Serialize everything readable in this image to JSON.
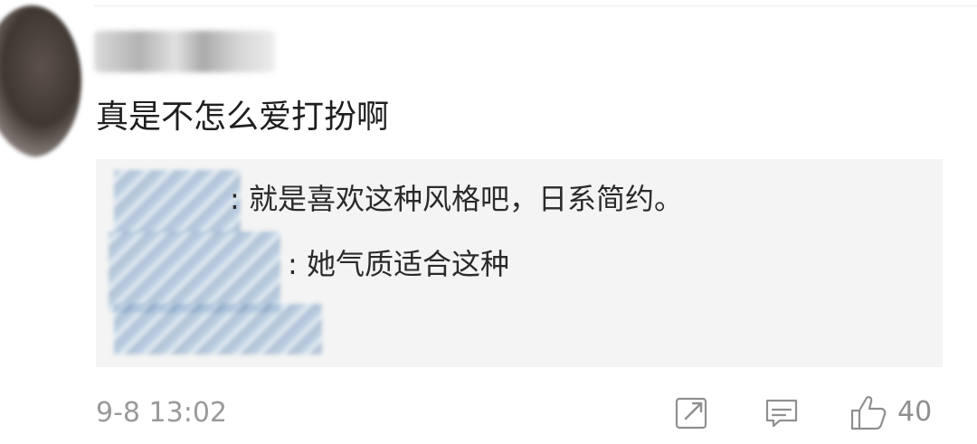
{
  "comment": {
    "text": "真是不怎么爱打扮啊",
    "timestamp": "9-8 13:02",
    "likes": "40",
    "replies": [
      {
        "text": ": 就是喜欢这种风格吧，日系简约。"
      },
      {
        "text": ": 她气质适合这种"
      }
    ]
  },
  "colors": {
    "text": "#1f1f1f",
    "meta": "#9a9a9a",
    "reply_bg": "#f4f4f4"
  },
  "icons": {
    "share": "share-icon",
    "reply": "comment-icon",
    "like": "thumbs-up-icon"
  }
}
